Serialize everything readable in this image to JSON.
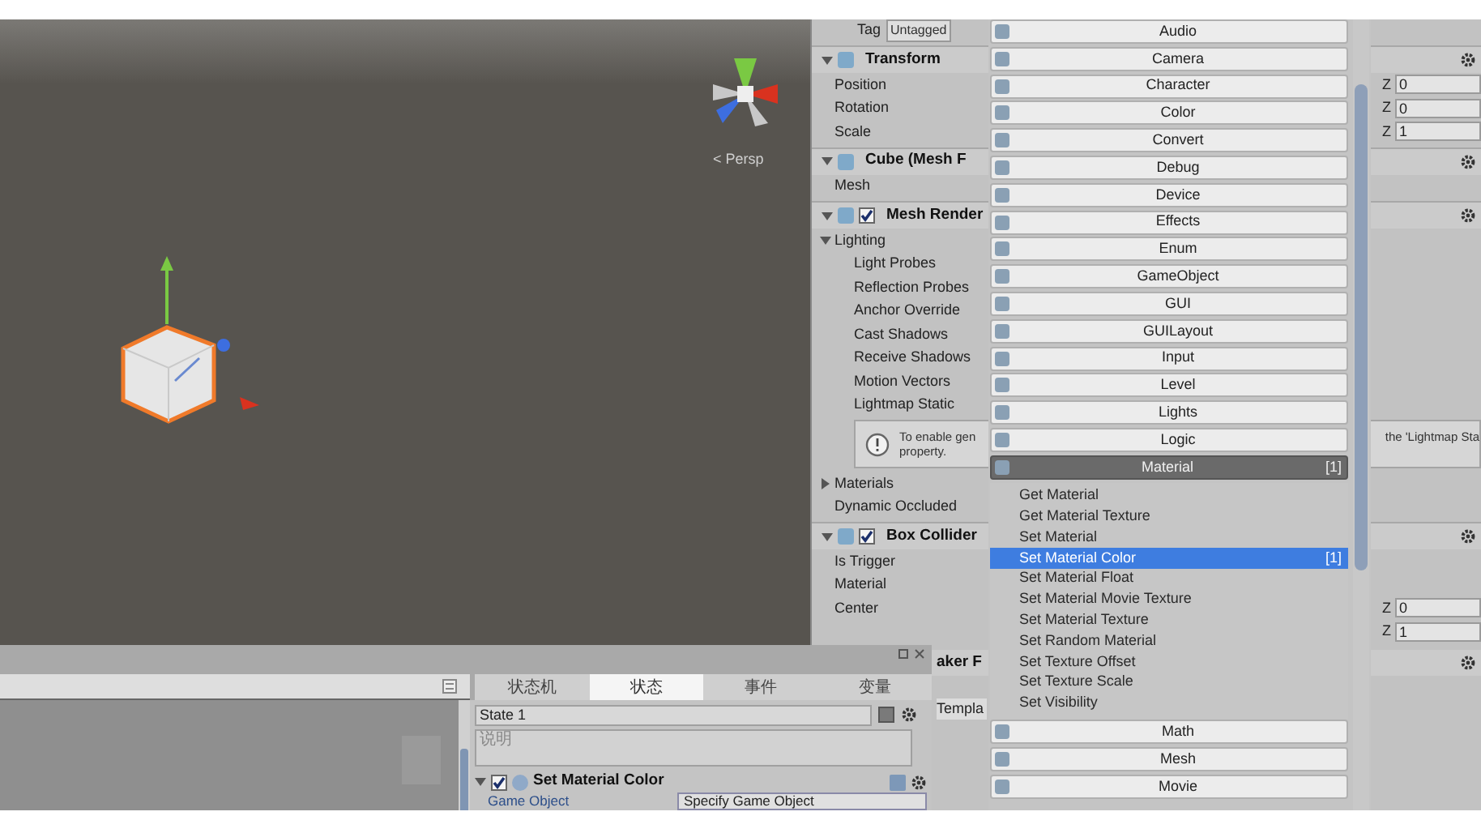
{
  "scene": {
    "view_arrow": "<",
    "view_label": "Persp"
  },
  "inspector": {
    "tag_label": "Tag",
    "tag_value": "Untagged",
    "rows": [
      {
        "kind": "header",
        "title": "Transform"
      },
      {
        "kind": "property",
        "label": "Position",
        "z_label": "Z",
        "z_value": "0"
      },
      {
        "kind": "property",
        "label": "Rotation",
        "z_label": "Z",
        "z_value": "0"
      },
      {
        "kind": "property",
        "label": "Scale",
        "z_label": "Z",
        "z_value": "1"
      },
      {
        "kind": "header",
        "title": "Cube (Mesh F"
      },
      {
        "kind": "property",
        "label": "Mesh"
      },
      {
        "kind": "header",
        "title": "Mesh Render",
        "checked": true
      },
      {
        "kind": "foldout",
        "label": "Lighting",
        "expanded": true,
        "children": [
          {
            "label": "Light Probes"
          },
          {
            "label": "Reflection Probes"
          },
          {
            "label": "Anchor Override"
          },
          {
            "label": "Cast Shadows"
          },
          {
            "label": "Receive Shadows"
          },
          {
            "label": "Motion Vectors"
          },
          {
            "label": "Lightmap Static"
          }
        ]
      },
      {
        "kind": "info",
        "lines": [
          "To enable gen",
          "property."
        ],
        "overflow_text": "the 'Lightmap Sta"
      },
      {
        "kind": "foldout",
        "label": "Materials",
        "expanded": false
      },
      {
        "kind": "property",
        "label": "Dynamic Occluded"
      },
      {
        "kind": "header",
        "title": "Box Collider",
        "checked": true
      },
      {
        "kind": "property",
        "label": "Is Trigger"
      },
      {
        "kind": "property",
        "label": "Material"
      },
      {
        "kind": "property",
        "label": "Center",
        "z_label": "Z",
        "z_value": "0"
      },
      {
        "kind": "property",
        "z_label": "Z",
        "z_value": "1"
      },
      {
        "kind": "partial_header",
        "text": "aker F"
      },
      {
        "kind": "partial_field",
        "text": "Templa"
      }
    ]
  },
  "menu": {
    "categories": [
      {
        "label": "Audio",
        "selected": false
      },
      {
        "label": "Camera",
        "selected": false
      },
      {
        "label": "Character",
        "selected": false
      },
      {
        "label": "Color",
        "selected": false
      },
      {
        "label": "Convert",
        "selected": false
      },
      {
        "label": "Debug",
        "selected": false
      },
      {
        "label": "Device",
        "selected": false
      },
      {
        "label": "Effects",
        "selected": false
      },
      {
        "label": "Enum",
        "selected": false
      },
      {
        "label": "GameObject",
        "selected": false
      },
      {
        "label": "GUI",
        "selected": false
      },
      {
        "label": "GUILayout",
        "selected": false
      },
      {
        "label": "Input",
        "selected": false
      },
      {
        "label": "Level",
        "selected": false
      },
      {
        "label": "Lights",
        "selected": false
      },
      {
        "label": "Logic",
        "selected": false
      },
      {
        "label": "Material",
        "selected": true,
        "badge": "[1]",
        "expanded": true,
        "children": [
          {
            "label": "Get Material",
            "selected": false
          },
          {
            "label": "Get Material Texture",
            "selected": false
          },
          {
            "label": "Set Material",
            "selected": false
          },
          {
            "label": "Set Material Color",
            "selected": true,
            "badge": "[1]"
          },
          {
            "label": "Set Material Float",
            "selected": false
          },
          {
            "label": "Set Material Movie Texture",
            "selected": false
          },
          {
            "label": "Set Material Texture",
            "selected": false
          },
          {
            "label": "Set Random Material",
            "selected": false
          },
          {
            "label": "Set Texture Offset",
            "selected": false
          },
          {
            "label": "Set Texture Scale",
            "selected": false
          },
          {
            "label": "Set Visibility",
            "selected": false
          }
        ]
      },
      {
        "label": "Math",
        "selected": false
      },
      {
        "label": "Mesh",
        "selected": false
      },
      {
        "label": "Movie",
        "selected": false
      }
    ]
  },
  "fsm_panel": {
    "tabs": [
      {
        "label": "状态机",
        "selected": false
      },
      {
        "label": "状态",
        "selected": true
      },
      {
        "label": "事件",
        "selected": false
      },
      {
        "label": "变量",
        "selected": false
      }
    ],
    "state_name": "State 1",
    "description_placeholder": "说明",
    "action": {
      "title": "Set Material Color",
      "enabled": true,
      "field_label": "Game Object",
      "field_value": "Specify Game Object"
    }
  }
}
